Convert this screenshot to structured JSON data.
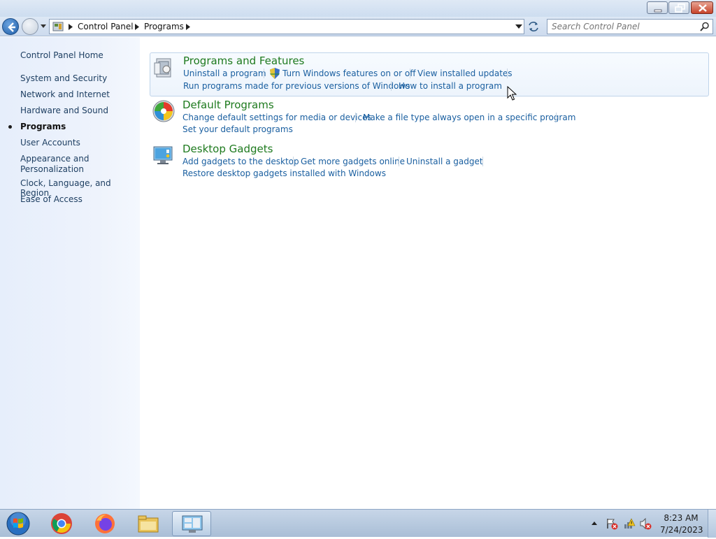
{
  "address_bar": {
    "crumbs": [
      "Control Panel",
      "Programs"
    ]
  },
  "search": {
    "placeholder": "Search Control Panel"
  },
  "left_pane": {
    "home_link": "Control Panel Home",
    "items": [
      {
        "label": "System and Security"
      },
      {
        "label": "Network and Internet"
      },
      {
        "label": "Hardware and Sound"
      },
      {
        "label": "Programs",
        "current": true
      },
      {
        "label": "User Accounts"
      },
      {
        "label": "Appearance and Personalization",
        "lines": [
          "Appearance and",
          "Personalization"
        ]
      },
      {
        "label": "Clock, Language, and Region"
      },
      {
        "label": "Ease of Access"
      }
    ]
  },
  "categories": [
    {
      "title": "Programs and Features",
      "icon": "programs-features-icon",
      "tasks": [
        "Uninstall a program",
        "Turn Windows features on or off",
        "View installed updates",
        "Run programs made for previous versions of Windows",
        "How to install a program"
      ]
    },
    {
      "title": "Default Programs",
      "icon": "default-programs-icon",
      "tasks": [
        "Change default settings for media or devices",
        "Make a file type always open in a specific program",
        "Set your default programs"
      ]
    },
    {
      "title": "Desktop Gadgets",
      "icon": "desktop-gadgets-icon",
      "tasks": [
        "Add gadgets to the desktop",
        "Get more gadgets online",
        "Uninstall a gadget",
        "Restore desktop gadgets installed with Windows"
      ]
    }
  ],
  "taskbar": {
    "apps": [
      "start-orb-icon",
      "chrome-icon",
      "firefox-icon",
      "file-explorer-icon",
      "control-panel-icon"
    ],
    "clock_time": "8:23 AM",
    "clock_date": "7/24/2023"
  },
  "colors": {
    "link": "#1a5fa0",
    "category_title": "#1e7a1e",
    "left_pane_bg": "#e6eefb"
  }
}
